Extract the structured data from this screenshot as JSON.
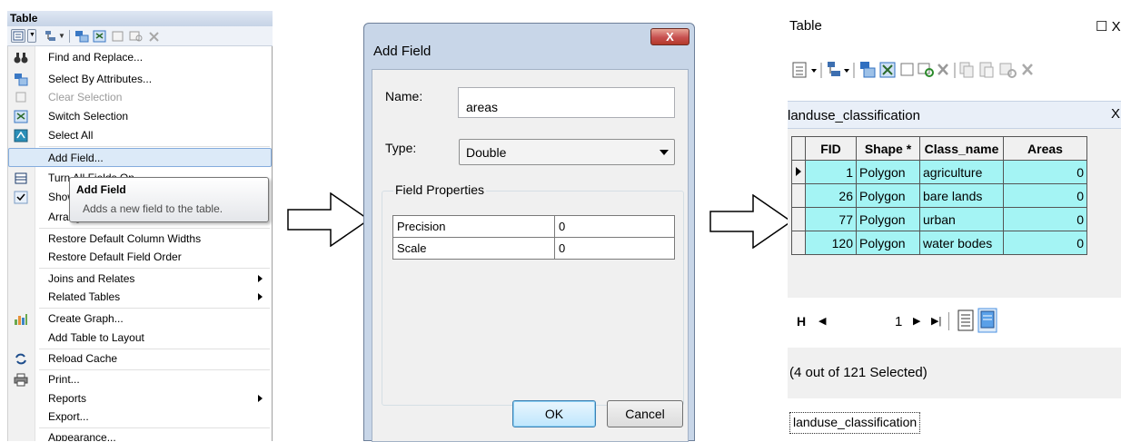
{
  "menu_panel": {
    "title": "Table",
    "items": [
      {
        "label": "Find and Replace...",
        "icon": "binoculars-icon"
      },
      {
        "label": "Select By Attributes...",
        "icon": "select-by-attributes-icon"
      },
      {
        "label": "Clear Selection",
        "icon": "clear-selection-icon",
        "disabled": true
      },
      {
        "label": "Switch Selection",
        "icon": "switch-selection-icon"
      },
      {
        "label": "Select All",
        "icon": "select-all-icon"
      },
      {
        "label": "Add Field...",
        "highlighted": true
      },
      {
        "label": "Turn All Fields On",
        "icon": "fields-icon"
      },
      {
        "label": "Show Field Aliases",
        "icon": "checkmark-icon"
      },
      {
        "label": "Arrange Tables"
      },
      {
        "label": "Restore Default Column Widths"
      },
      {
        "label": "Restore Default Field Order"
      },
      {
        "label": "Joins and Relates",
        "submenu": true
      },
      {
        "label": "Related Tables",
        "submenu": true
      },
      {
        "label": "Create Graph...",
        "icon": "bar-chart-icon"
      },
      {
        "label": "Add Table to Layout"
      },
      {
        "label": "Reload Cache",
        "icon": "reload-icon"
      },
      {
        "label": "Print...",
        "icon": "printer-icon"
      },
      {
        "label": "Reports",
        "submenu": true
      },
      {
        "label": "Export..."
      },
      {
        "label": "Appearance..."
      }
    ],
    "tooltip": {
      "title": "Add Field",
      "description": "Adds a new field to the table."
    }
  },
  "add_field_dialog": {
    "title": "Add Field",
    "close_label": "X",
    "name_label": "Name:",
    "name_value": "areas",
    "type_label": "Type:",
    "type_value": "Double",
    "field_properties_label": "Field Properties",
    "properties": [
      {
        "name": "Precision",
        "value": "0"
      },
      {
        "name": "Scale",
        "value": "0"
      }
    ],
    "ok_label": "OK",
    "cancel_label": "Cancel"
  },
  "table_window": {
    "title": "Table",
    "window_controls": "☐ X",
    "tab_name": "landuse_classification",
    "tab_close": "X",
    "columns": [
      "FID",
      "Shape *",
      "Class_name",
      "Areas"
    ],
    "rows": [
      {
        "fid": "1",
        "shape": "Polygon",
        "class_name": "agriculture",
        "areas": "0",
        "current": true
      },
      {
        "fid": "26",
        "shape": "Polygon",
        "class_name": "bare lands",
        "areas": "0"
      },
      {
        "fid": "77",
        "shape": "Polygon",
        "class_name": "urban",
        "areas": "0"
      },
      {
        "fid": "120",
        "shape": "Polygon",
        "class_name": "water bodes",
        "areas": "0"
      }
    ],
    "navigator": {
      "first": "H",
      "prev": "◀",
      "record": "1",
      "next": "▶",
      "last": "▶|"
    },
    "selection_status": "(4 out of 121 Selected)",
    "bottom_tab": "landuse_classification"
  },
  "colors": {
    "selected_row": "#a4f4f4",
    "menu_highlight": "#dceaf8",
    "dialog_frame": "#c8d6e8",
    "close_button": "#c75050"
  }
}
